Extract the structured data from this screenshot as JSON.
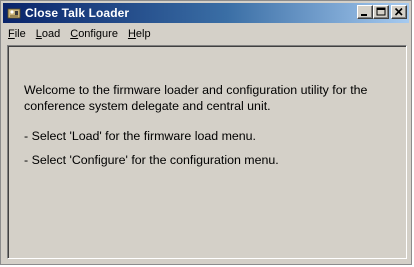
{
  "window": {
    "title": "Close Talk Loader",
    "icon": "close-talk-app-icon",
    "controls": {
      "minimize_icon": "minimize-icon",
      "maximize_icon": "maximize-icon",
      "close_icon": "close-icon"
    }
  },
  "menu": {
    "items": [
      {
        "accel": "F",
        "rest": "ile"
      },
      {
        "accel": "L",
        "rest": "oad"
      },
      {
        "accel": "C",
        "rest": "onfigure"
      },
      {
        "accel": "H",
        "rest": "elp"
      }
    ]
  },
  "content": {
    "welcome": "Welcome to the firmware loader and configuration utility for the conference system delegate and central unit.",
    "bullets": [
      "- Select 'Load' for the firmware load menu.",
      "- Select 'Configure' for the configuration menu."
    ]
  },
  "colors": {
    "title_gradient_start": "#0a246a",
    "title_gradient_end": "#a6caf0",
    "window_face": "#d4d0c8"
  }
}
